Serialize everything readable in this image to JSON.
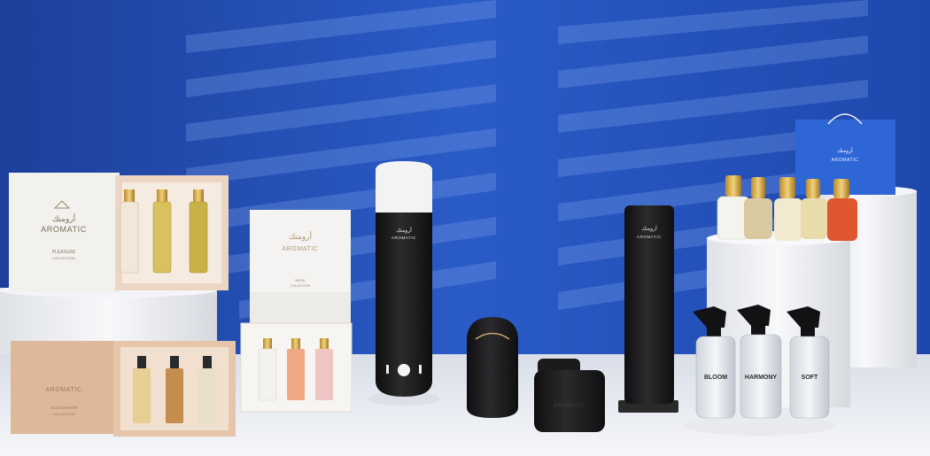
{
  "brand": "AROMATIC",
  "brand_arabic": "أرومتك",
  "collections": {
    "pleasure": [
      "PLEASURE",
      "COLLECTION"
    ],
    "musk": [
      "MUSK",
      "COLLECTION"
    ],
    "oud": [
      "OUD BAKHOR",
      "COLLECTION"
    ]
  },
  "spray_labels": [
    "BLOOM",
    "HARMONY",
    "SOFT"
  ],
  "colors": {
    "wall_blue": "#2b5bc4",
    "wall_shadow": "#1c3f9a",
    "pedestal_white": "#eef0f3",
    "diffuser_black": "#1b1b1d",
    "peach_box": "#e8c3a6"
  }
}
